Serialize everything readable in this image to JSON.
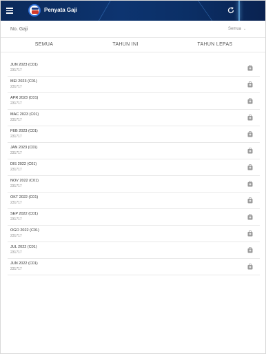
{
  "header": {
    "title": "Penyata Gaji",
    "menu_icon": "menu-icon",
    "refresh_icon": "refresh-icon"
  },
  "filter": {
    "label": "No. Gaji",
    "select_value": "Semua"
  },
  "tabs": [
    {
      "label": "SEMUA"
    },
    {
      "label": "TAHUN INI"
    },
    {
      "label": "TAHUN LEPAS"
    }
  ],
  "rows": [
    {
      "title": "JUN 2023 (C01)",
      "sub": "231717"
    },
    {
      "title": "MEI 2023 (C01)",
      "sub": "231717"
    },
    {
      "title": "APR 2023 (C01)",
      "sub": "231717"
    },
    {
      "title": "MAC 2023 (C01)",
      "sub": "231717"
    },
    {
      "title": "FEB 2023 (C01)",
      "sub": "231717"
    },
    {
      "title": "JAN 2023 (C01)",
      "sub": "231717"
    },
    {
      "title": "DIS 2022 (C01)",
      "sub": "231717"
    },
    {
      "title": "NOV 2022 (C01)",
      "sub": "231717"
    },
    {
      "title": "OKT 2022 (C01)",
      "sub": "231717"
    },
    {
      "title": "SEP 2022 (C01)",
      "sub": "231717"
    },
    {
      "title": "OGO 2022 (C01)",
      "sub": "231717"
    },
    {
      "title": "JUL 2022 (C01)",
      "sub": "231717"
    },
    {
      "title": "JUN 2022 (C01)",
      "sub": "231717"
    }
  ],
  "colors": {
    "header_bg": "#0d3470",
    "icon_gray": "#9a9a9a"
  }
}
